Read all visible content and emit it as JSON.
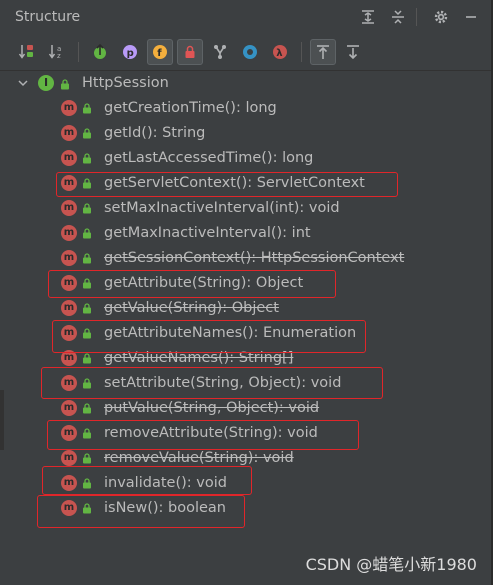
{
  "header": {
    "title": "Structure"
  },
  "title_actions": [
    {
      "name": "expand-all-icon"
    },
    {
      "name": "collapse-all-icon"
    },
    {
      "name": "gear-icon"
    },
    {
      "name": "hide-icon"
    }
  ],
  "toolbar": {
    "tools": [
      {
        "name": "sort-by-visibility-icon",
        "label": "↓⇅"
      },
      {
        "name": "sort-alphabetically-icon",
        "label": "az"
      },
      {
        "name": "show-inherited-icon",
        "label": "↑"
      },
      {
        "name": "show-properties-icon",
        "label": "p"
      },
      {
        "name": "show-fields-icon",
        "label": "f"
      },
      {
        "name": "show-non-public-icon",
        "label": "lock"
      },
      {
        "name": "show-includes-icon",
        "label": "Y"
      },
      {
        "name": "show-anonymous-icon",
        "label": "○"
      },
      {
        "name": "show-lambdas-icon",
        "label": "λ"
      },
      {
        "name": "autoscroll-to-source-icon",
        "label": "↥"
      },
      {
        "name": "autoscroll-from-source-icon",
        "label": "↧"
      }
    ]
  },
  "tree": {
    "root": {
      "icon_letter": "I",
      "label": "HttpSession"
    },
    "method_icon_letter": "m",
    "methods": [
      {
        "label": "getCreationTime(): long",
        "deprecated": false
      },
      {
        "label": "getId(): String",
        "deprecated": false
      },
      {
        "label": "getLastAccessedTime(): long",
        "deprecated": false
      },
      {
        "label": "getServletContext(): ServletContext",
        "deprecated": false
      },
      {
        "label": "setMaxInactiveInterval(int): void",
        "deprecated": false
      },
      {
        "label": "getMaxInactiveInterval(): int",
        "deprecated": false
      },
      {
        "label": "getSessionContext(): HttpSessionContext",
        "deprecated": true
      },
      {
        "label": "getAttribute(String): Object",
        "deprecated": false
      },
      {
        "label": "getValue(String): Object",
        "deprecated": true
      },
      {
        "label": "getAttributeNames(): Enumeration",
        "deprecated": false
      },
      {
        "label": "getValueNames(): String[]",
        "deprecated": true
      },
      {
        "label": "setAttribute(String, Object): void",
        "deprecated": false
      },
      {
        "label": "putValue(String, Object): void",
        "deprecated": true
      },
      {
        "label": "removeAttribute(String): void",
        "deprecated": false
      },
      {
        "label": "removeValue(String): void",
        "deprecated": true
      },
      {
        "label": "invalidate(): void",
        "deprecated": false
      },
      {
        "label": "isNew(): boolean",
        "deprecated": false
      }
    ]
  },
  "watermark": "CSDN @蜡笔小新1980",
  "colors": {
    "background": "#3c3f41",
    "text": "#bbbbbb",
    "method_icon": "#c75450",
    "interface_icon": "#62b543",
    "lock": "#62b543",
    "highlight_box": "#e0262a"
  }
}
